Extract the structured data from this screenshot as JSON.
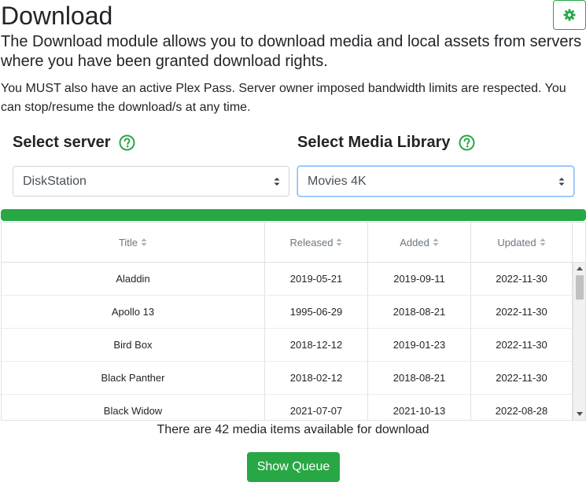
{
  "header": {
    "title": "Download",
    "settings_icon": "gear-icon"
  },
  "intro": {
    "lead": "The Download module allows you to download media and local assets from servers where you have been granted download rights.",
    "note": "You MUST also have an active Plex Pass. Server owner imposed bandwidth limits are respected. You can stop/resume the download/s at any time."
  },
  "server_select": {
    "label": "Select server",
    "help_icon": "question-circle-icon",
    "value": "DiskStation"
  },
  "library_select": {
    "label": "Select Media Library",
    "help_icon": "question-circle-icon",
    "value": "Movies 4K"
  },
  "progress": {
    "percent": 100
  },
  "table": {
    "columns": [
      "Title",
      "Released",
      "Added",
      "Updated"
    ],
    "rows": [
      [
        "Aladdin",
        "2019-05-21",
        "2019-09-11",
        "2022-11-30"
      ],
      [
        "Apollo 13",
        "1995-06-29",
        "2018-08-21",
        "2022-11-30"
      ],
      [
        "Bird Box",
        "2018-12-12",
        "2019-01-23",
        "2022-11-30"
      ],
      [
        "Black Panther",
        "2018-02-12",
        "2018-08-21",
        "2022-11-30"
      ],
      [
        "Black Widow",
        "2021-07-07",
        "2021-10-13",
        "2022-08-28"
      ]
    ]
  },
  "footer": {
    "count_text": "There are 42 media items available for download",
    "queue_button": "Show Queue"
  },
  "colors": {
    "accent": "#28a745",
    "select_focus": "#80bdff"
  }
}
